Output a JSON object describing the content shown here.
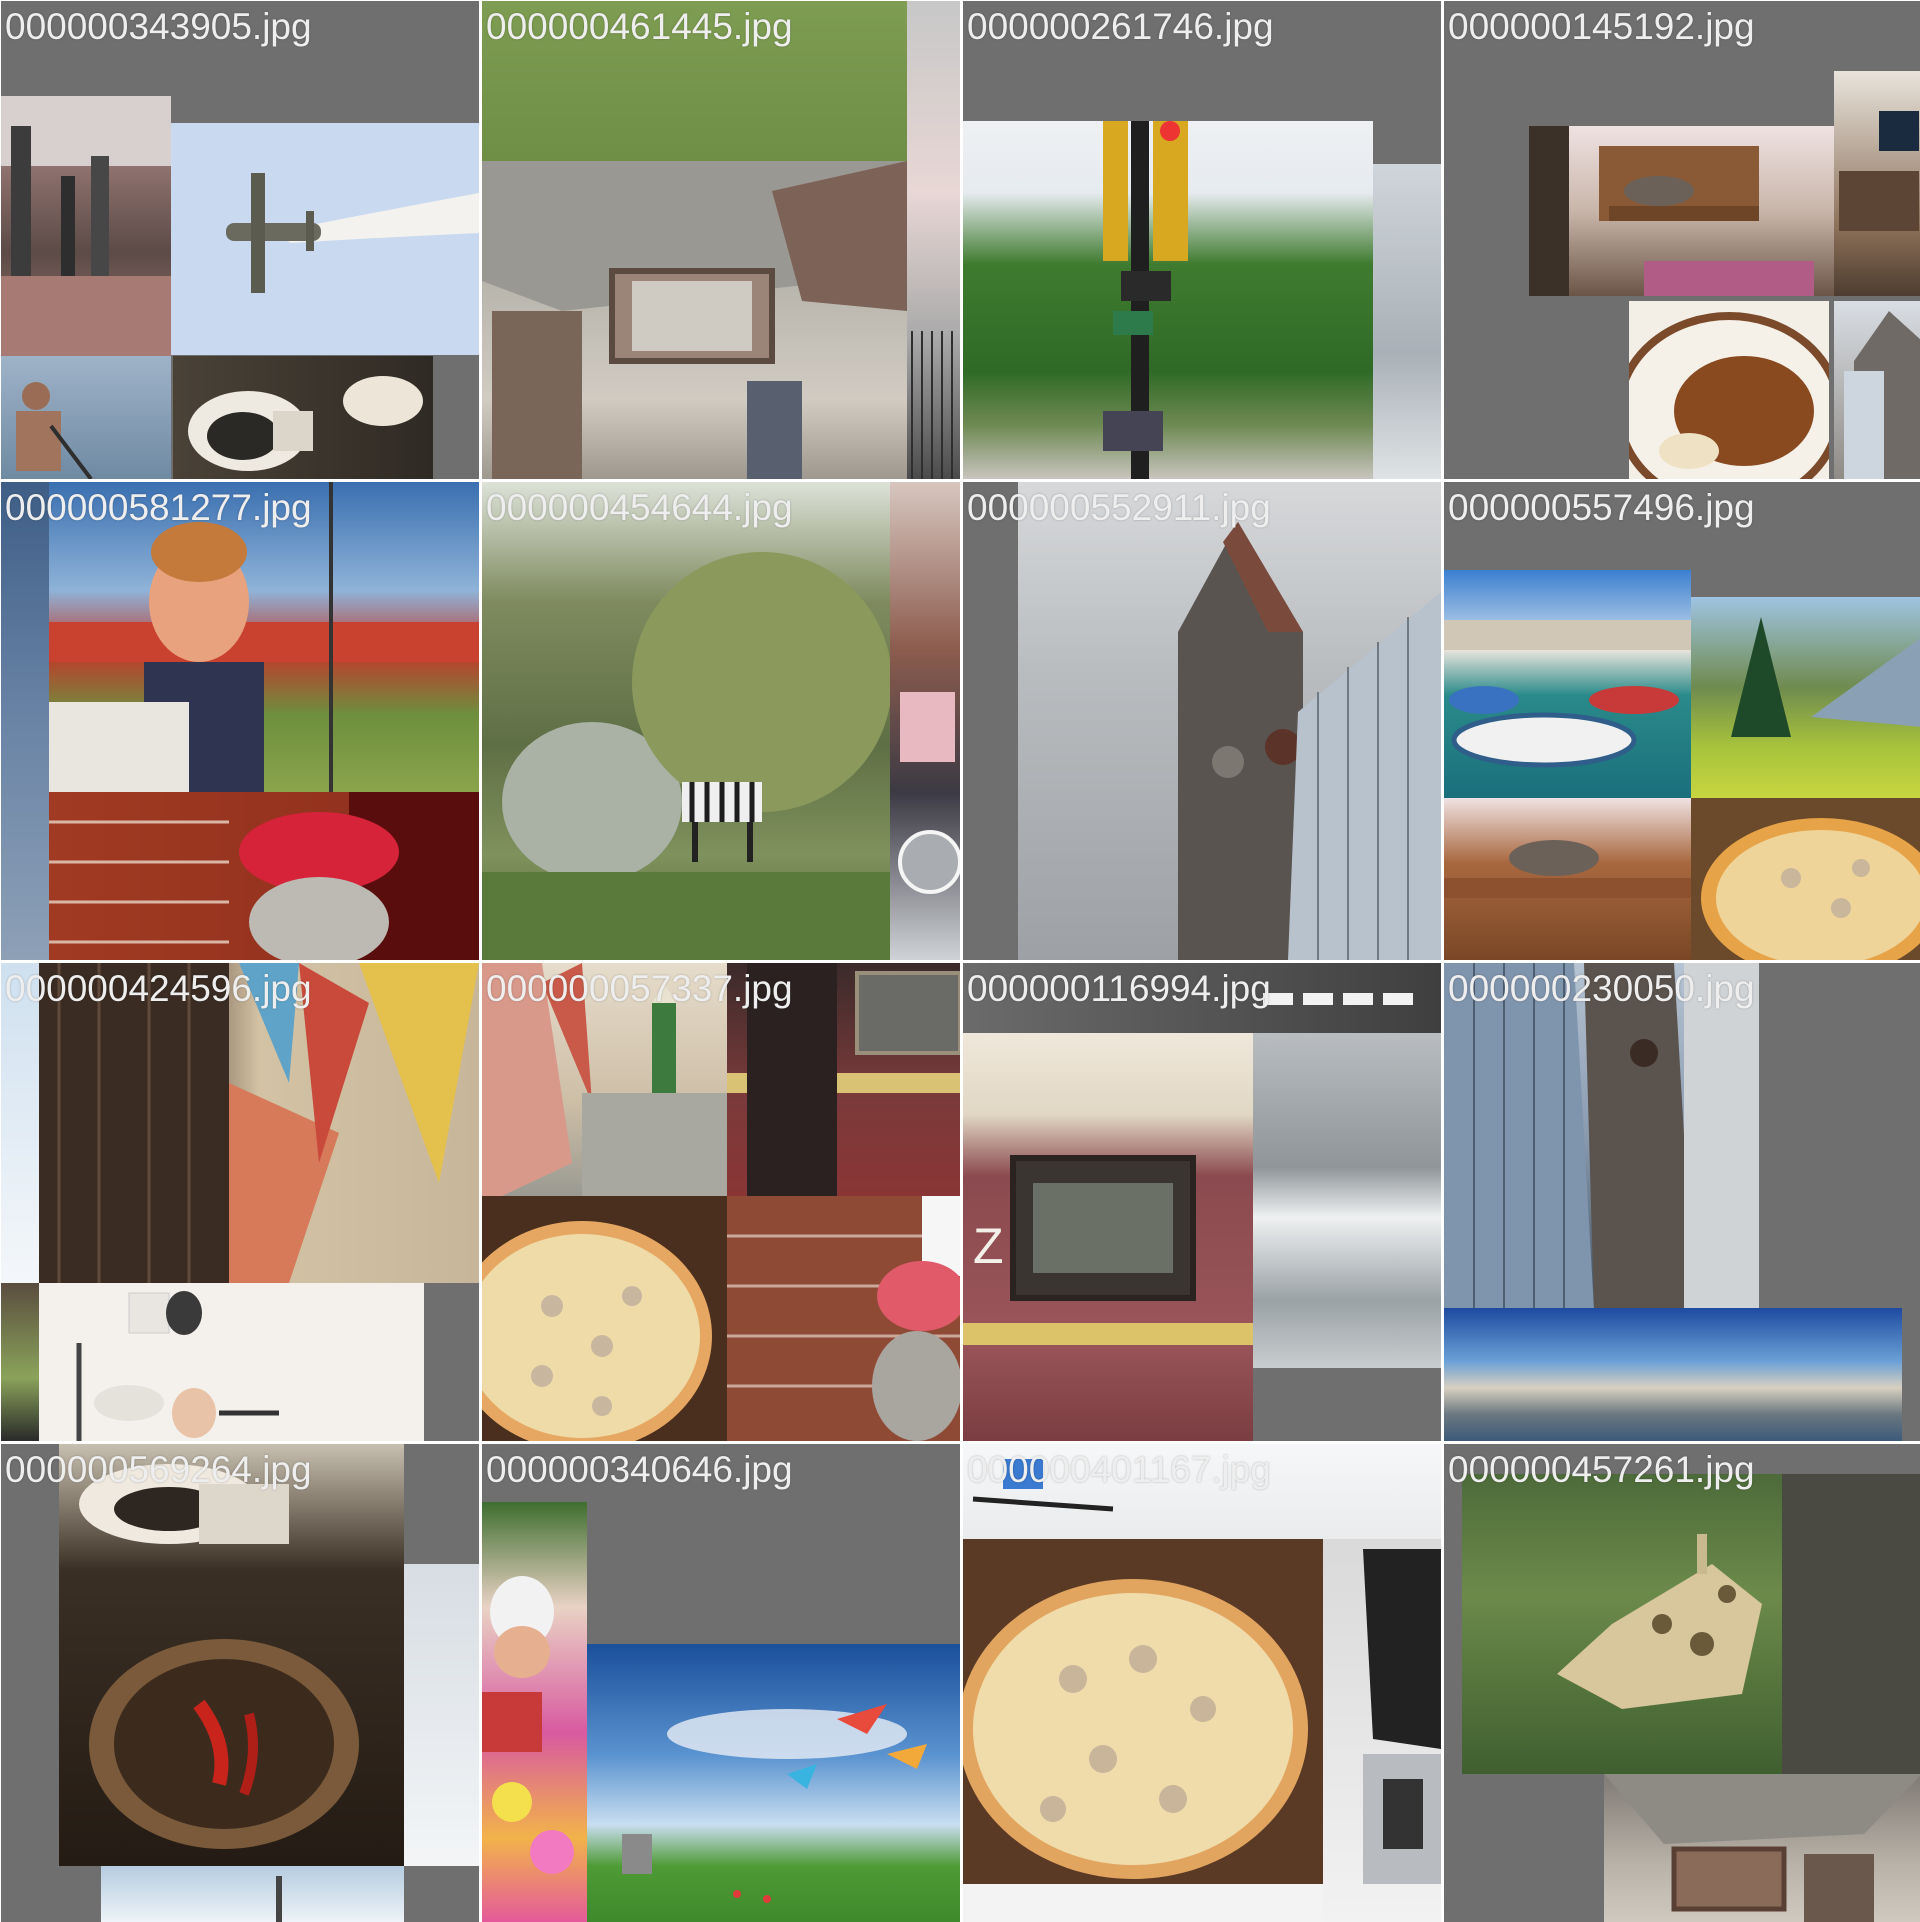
{
  "tiles": [
    {
      "filename": "000000343905.jpg",
      "scenes": [
        "people walking on wet street",
        "vintage airplane with smoke trail",
        "man rowing on water",
        "electronic toilet seat",
        "dark toilet"
      ]
    },
    {
      "filename": "000000461445.jpg",
      "scenes": [
        "green grass field",
        "derelict room interior with broken cabinets",
        "building with iron fence"
      ]
    },
    {
      "filename": "000000261746.jpg",
      "scenes": [
        "traffic lights and street signs with trees",
        "ocean waves"
      ]
    },
    {
      "filename": "000000145192.jpg",
      "scenes": [
        "cat lying on wooden table in living room",
        "office desk with computer",
        "bowl of curry with pasta",
        "church tower"
      ]
    },
    {
      "filename": "000000581277.jpg",
      "scenes": [
        "boy eating sandwich at baseball stadium",
        "denim fabric",
        "dog wearing red cap by brick wall"
      ]
    },
    {
      "filename": "000000454644.jpg",
      "scenes": [
        "zebra grazing among trees",
        "desk with papers and earphones"
      ]
    },
    {
      "filename": "000000552911.jpg",
      "scenes": [
        "clock tower next to glass building under clouds"
      ]
    },
    {
      "filename": "000000557496.jpg",
      "scenes": [
        "harbor with fishing boats",
        "alpine meadow and mountains",
        "cat on wooden table",
        "pizza"
      ]
    },
    {
      "filename": "000000424596.jpg",
      "scenes": [
        "colorful kites hanging by old wooden shutters",
        "child in restroom",
        "street with building"
      ]
    },
    {
      "filename": "000000057337.jpg",
      "scenes": [
        "kite decorations",
        "woman with conical hat on street",
        "red train carriage door",
        "mushroom pizza",
        "dog in red cap by brick wall"
      ]
    },
    {
      "filename": "000000116994.jpg",
      "scenes": [
        "red and yellow train carriage window",
        "ocean waves",
        "road crossing"
      ]
    },
    {
      "filename": "000000230050.jpg",
      "scenes": [
        "glass building reflecting clock tower",
        "harbor panorama"
      ]
    },
    {
      "filename": "000000569264.jpg",
      "scenes": [
        "toilet and bowl with chili peppers",
        "snowy landscape",
        "church spire in sky"
      ]
    },
    {
      "filename": "000000340646.jpg",
      "scenes": [
        "child on floral blanket",
        "kites flying over green field"
      ]
    },
    {
      "filename": "000000401167.jpg",
      "scenes": [
        "skier on snow",
        "mushroom pizza",
        "laptop computer"
      ]
    },
    {
      "filename": "000000457261.jpg",
      "scenes": [
        "giraffe head near tree trunk",
        "derelict room interior"
      ]
    }
  ]
}
